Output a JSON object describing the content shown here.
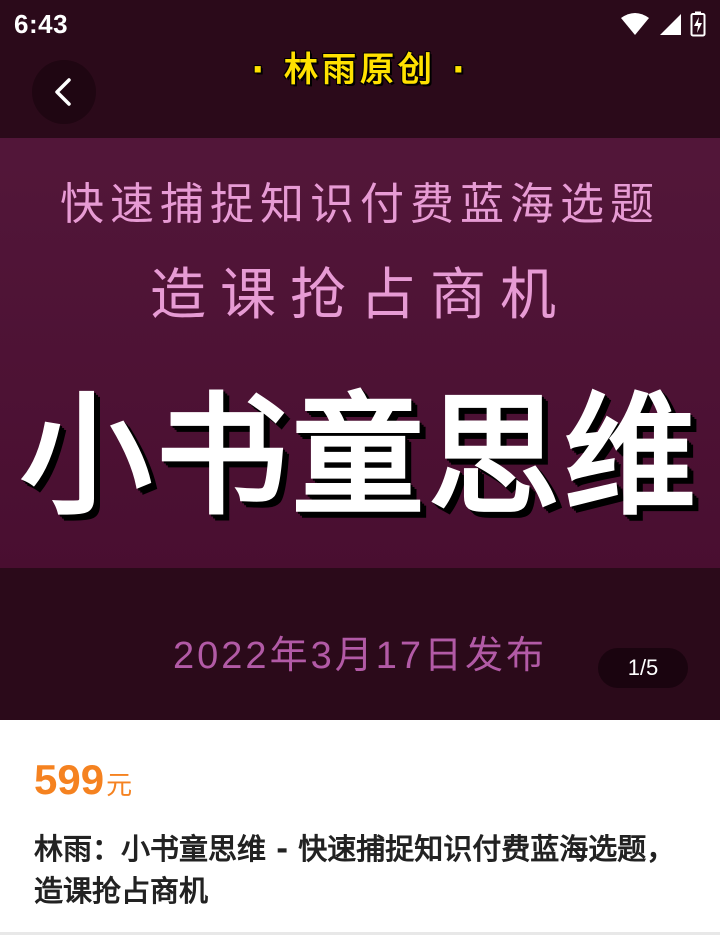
{
  "status_bar": {
    "time": "6:43",
    "icons": [
      "wifi-icon",
      "signal-icon",
      "battery-charging-icon"
    ]
  },
  "hero": {
    "brand": "· 林雨原创 ·",
    "subtitle_line1": "快速捕捉知识付费蓝海选题",
    "subtitle_line2": "造课抢占商机",
    "main_title": "小书童思维",
    "date": "2022年3月17日发布",
    "pager": "1/5",
    "back_icon": "chevron-left-icon",
    "colors": {
      "background": "#2b0a1a",
      "band": "#4d0f33",
      "subtitle": "#e79bd4",
      "brand": "#ffe100",
      "date": "#b25aa6"
    }
  },
  "product": {
    "price": "599",
    "price_unit": "元",
    "title": "林雨：小书童思维 - 快速捕捉知识付费蓝海选题，造课抢占商机",
    "colors": {
      "price": "#f58220"
    }
  }
}
